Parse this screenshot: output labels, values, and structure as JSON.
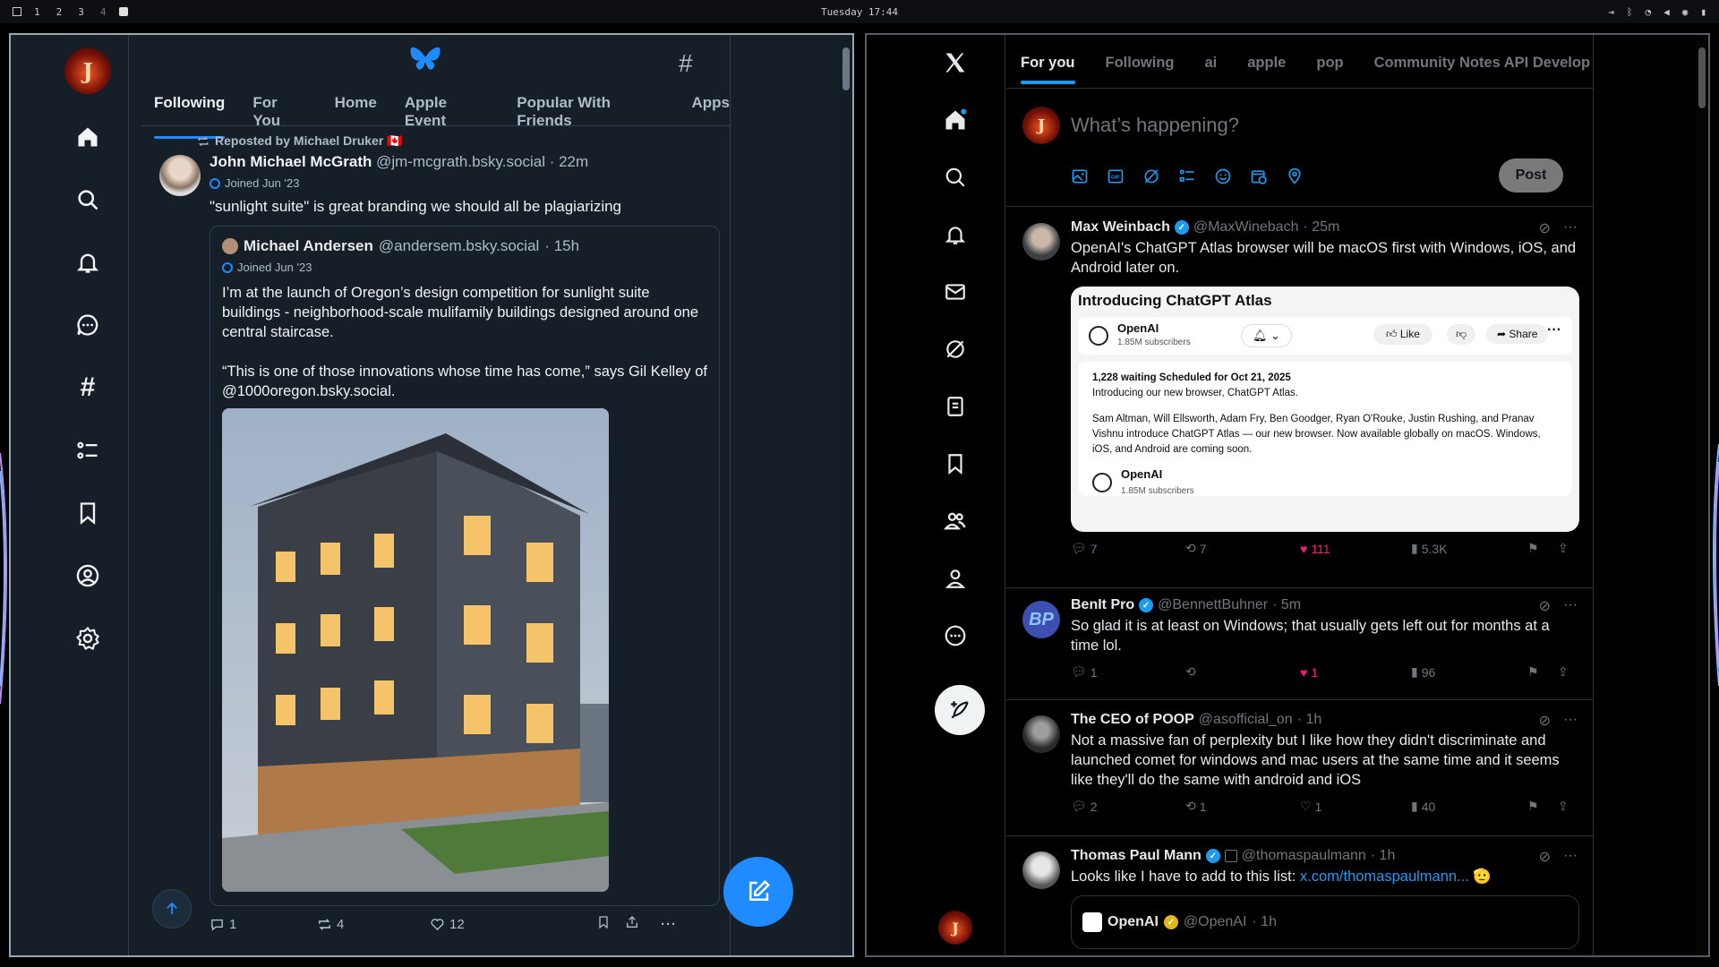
{
  "topbar": {
    "workspaces": [
      "1",
      "2",
      "3",
      "4"
    ],
    "clock": "Tuesday 17:44"
  },
  "bluesky": {
    "tabs": [
      "Following",
      "For You",
      "Home",
      "Apple Event",
      "Popular With Friends",
      "Apps"
    ],
    "post": {
      "repost_label": "Reposted by Michael Druker 🇨🇦",
      "author": "John Michael McGrath",
      "handle": "@jm-mcgrath.bsky.social",
      "time": "· 22m",
      "joined": "Joined Jun '23",
      "text": "\"sunlight suite\" is great branding we should all be plagiarizing",
      "quote": {
        "author": "Michael Andersen",
        "handle": "@andersem.bsky.social",
        "time": "· 15h",
        "joined": "Joined Jun '23",
        "text": "I’m at the launch of Oregon’s design competition for sunlight suite buildings - neighborhood-scale mulifamily buildings designed around one central staircase.\n\n“This is one of those innovations whose time has come,” says Gil Kelley of @1000oregon.bsky.social."
      },
      "replies": "1",
      "reposts": "4",
      "likes": "12"
    }
  },
  "x": {
    "tabs": [
      "For you",
      "Following",
      "ai",
      "apple",
      "pop",
      "Community Notes API Develop"
    ],
    "compose_placeholder": "What’s happening?",
    "post_button": "Post",
    "tweets": [
      {
        "author": "Max Weinbach",
        "handle": "@MaxWinebach",
        "time": "· 25m",
        "text": "OpenAI's ChatGPT Atlas browser will be macOS first with Windows, iOS, and Android later on.",
        "card": {
          "title": "Introducing ChatGPT Atlas",
          "channel": "OpenAI",
          "subscribers": "1.85M subscribers",
          "like": "Like",
          "share": "Share",
          "waiting": "1,228 waiting",
          "scheduled": "Scheduled for Oct 21, 2025",
          "line1": "Introducing our new browser, ChatGPT Atlas.",
          "desc": "Sam Altman, Will Ellsworth, Adam Fry, Ben Goodger, Ryan O'Rouke, Justin Rushing, and Pranav Vishnu introduce ChatGPT Atlas — our new browser. Now available globally on macOS. Windows, iOS, and Android are coming soon."
        },
        "replies": "7",
        "retweets": "7",
        "likes": "111",
        "views": "5.3K"
      },
      {
        "author": "BenIt Pro",
        "handle": "@BennettBuhner",
        "time": "· 5m",
        "text": "So glad it is at least on Windows; that usually gets left out for months at a time lol.",
        "replies": "1",
        "retweets": "",
        "likes": "1",
        "views": "96"
      },
      {
        "author": "The CEO of POOP",
        "handle": "@asofficial_on",
        "time": "· 1h",
        "text": "Not a massive fan of perplexity but I like how they didn't discriminate and launched comet for windows and mac users at the same time and it seems like they'll do the same with android and iOS",
        "replies": "2",
        "retweets": "1",
        "likes": "1",
        "views": "40"
      },
      {
        "author": "Thomas Paul Mann",
        "handle": "@thomaspaulmann",
        "time": "· 1h",
        "text_prefix": "Looks like I have to add to this list: ",
        "link": "x.com/thomaspaulmann...",
        "emoji": "🫡",
        "quoted_author": "OpenAI",
        "quoted_handle": "@OpenAI",
        "quoted_time": "· 1h"
      }
    ]
  }
}
